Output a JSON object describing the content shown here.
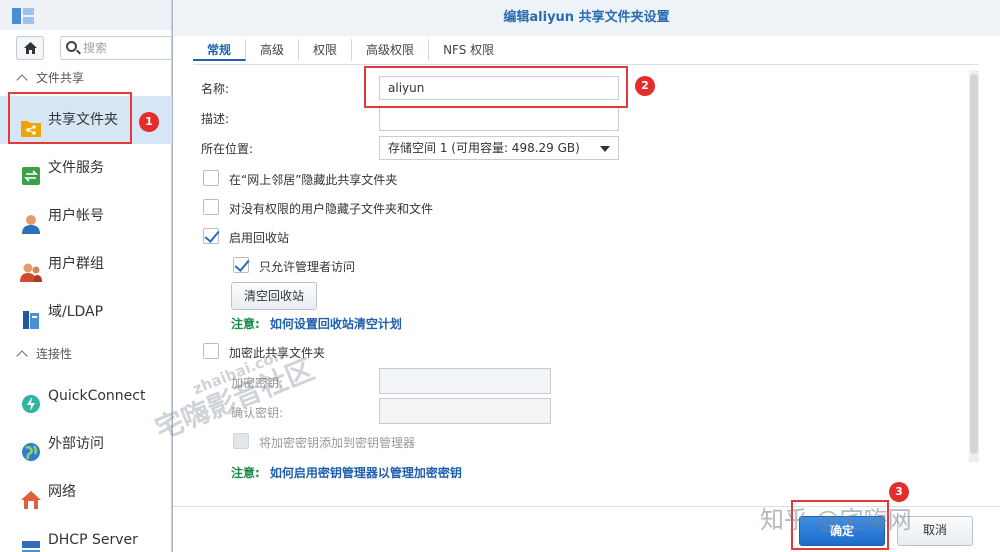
{
  "sidebar": {
    "search_placeholder": "搜索",
    "sections": [
      {
        "label": "文件共享"
      },
      {
        "label": "连接性"
      }
    ],
    "items": [
      {
        "label": "共享文件夹"
      },
      {
        "label": "文件服务"
      },
      {
        "label": "用户帐号"
      },
      {
        "label": "用户群组"
      },
      {
        "label": "域/LDAP"
      },
      {
        "label": "QuickConnect"
      },
      {
        "label": "外部访问"
      },
      {
        "label": "网络"
      },
      {
        "label": "DHCP Server"
      }
    ]
  },
  "dialog": {
    "title": "编辑aliyun 共享文件夹设置",
    "tabs": [
      "常规",
      "高级",
      "权限",
      "高级权限",
      "NFS 权限"
    ],
    "fields": {
      "name_label": "名称:",
      "name_value": "aliyun",
      "desc_label": "描述:",
      "desc_value": "",
      "location_label": "所在位置:",
      "location_value": "存储空间 1 (可用容量:  498.29 GB)"
    },
    "checkboxes": {
      "hide_network": {
        "label": "在“网上邻居”隐藏此共享文件夹",
        "checked": false
      },
      "hide_subfolders": {
        "label": "对没有权限的用户隐藏子文件夹和文件",
        "checked": false
      },
      "recycle_bin": {
        "label": "启用回收站",
        "checked": true
      },
      "admin_only": {
        "label": "只允许管理者访问",
        "checked": true
      },
      "encrypt": {
        "label": "加密此共享文件夹",
        "checked": false
      },
      "add_key_manager": {
        "label": "将加密密钥添加到密钥管理器",
        "checked": false
      }
    },
    "empty_recycle_button": "清空回收站",
    "note1": {
      "prefix": "注意:",
      "link": "如何设置回收站清空计划"
    },
    "encrypt_key_label": "加密密钥:",
    "confirm_key_label": "确认密钥:",
    "note2": {
      "prefix": "注意:",
      "link": "如何启用密钥管理器以管理加密密钥"
    },
    "ok_button": "确定",
    "cancel_button": "取消"
  },
  "annotations": [
    "1",
    "2",
    "3"
  ],
  "watermarks": {
    "site": "zhaihai.com",
    "community": "宅嗨影音社区",
    "zhihu": "知乎 @宅嗨网"
  },
  "colors": {
    "accent": "#2a6cb0",
    "highlight_red": "#e23a3a",
    "note_green": "#1a8a4a",
    "primary_button": "#1d6cc8"
  }
}
